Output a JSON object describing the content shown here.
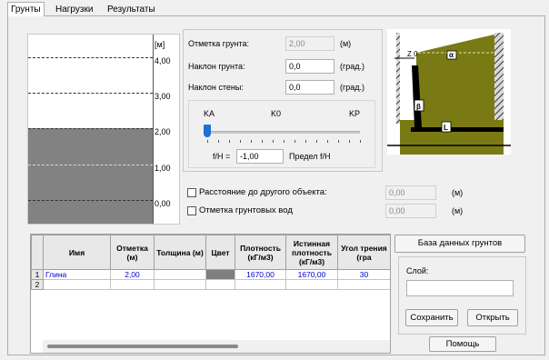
{
  "tabs": [
    "Грунты",
    "Нагрузки",
    "Результаты"
  ],
  "scale": {
    "unit": "[м]",
    "ticks": [
      "4,00",
      "3,00",
      "2,00",
      "1,00",
      "0,00"
    ]
  },
  "params": {
    "ground_level_label": "Отметка грунта:",
    "ground_level_value": "2,00",
    "ground_level_unit": "(м)",
    "ground_slope_label": "Наклон грунта:",
    "ground_slope_value": "0,0",
    "ground_slope_unit": "(град.)",
    "wall_slope_label": "Наклон стены:",
    "wall_slope_value": "0,0",
    "wall_slope_unit": "(град.)"
  },
  "slider": {
    "labels": [
      "KA",
      "K0",
      "KP"
    ],
    "position": 0.0,
    "fh_label": "f/H =",
    "fh_value": "-1,00",
    "fh_limit_label": "Предел f/H"
  },
  "diagram": {
    "z0_label": "Z 0",
    "alpha_label": "α",
    "beta_label": "β",
    "L_label": "L",
    "soil_color": "#7a7a14",
    "wall_color": "#000000"
  },
  "options": {
    "distance_label": "Расстояние до другого объекта:",
    "distance_value": "0,00",
    "distance_unit": "(м)",
    "groundwater_label": "Отметка грунтовых вод",
    "groundwater_value": "0,00",
    "groundwater_unit": "(м)"
  },
  "table": {
    "headers": [
      "Имя",
      "Отметка (м)",
      "Толщина (м)",
      "Цвет",
      "Плотность (кГ/м3)",
      "Истинная плотность (кГ/м3)",
      "Угол трения (гра"
    ],
    "rows": [
      {
        "num": "1",
        "name": "Глина",
        "level": "2,00",
        "thickness": "",
        "color": "#7f7f7f",
        "density": "1670,00",
        "true_density": "1670,00",
        "friction": "30"
      },
      {
        "num": "2",
        "name": "",
        "level": "",
        "thickness": "",
        "color": "",
        "density": "",
        "true_density": "",
        "friction": ""
      }
    ]
  },
  "right_panel": {
    "db_button": "База данных грунтов",
    "layer_label": "Слой:",
    "layer_value": "",
    "save_button": "Сохранить",
    "open_button": "Открыть",
    "help_button": "Помощь"
  }
}
